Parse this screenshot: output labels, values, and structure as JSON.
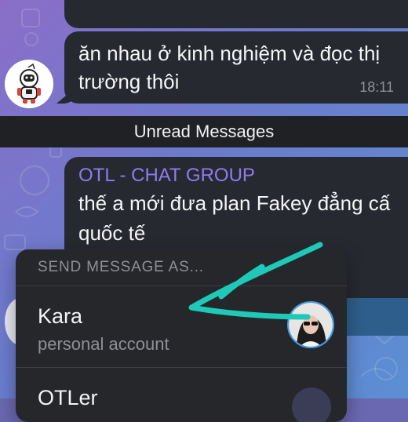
{
  "messages": {
    "top_partial": "",
    "message_1": {
      "line1": "ăn nhau ở kinh nghiệm và đọc thị",
      "line2": "trường thôi",
      "time": "18:11"
    },
    "unread_separator": "Unread Messages",
    "message_2": {
      "sender": "OTL - CHAT GROUP",
      "line1": "thế a mới đưa plan Fakey đẳng cấ",
      "line2": "quốc tế"
    }
  },
  "send_as_menu": {
    "header": "SEND MESSAGE AS...",
    "items": [
      {
        "name": "Kara",
        "subtitle": "personal account",
        "avatar_icon": "profile-photo"
      },
      {
        "name": "OTLer",
        "subtitle": "",
        "avatar_icon": "group-avatar"
      }
    ]
  },
  "annotation": {
    "arrow_color": "#1ec9b7"
  },
  "colors": {
    "bubble": "#262a30",
    "sender_name": "#8f7bf0",
    "menu_bg": "#25272b",
    "avatar_ring": "#3e9ee6"
  }
}
